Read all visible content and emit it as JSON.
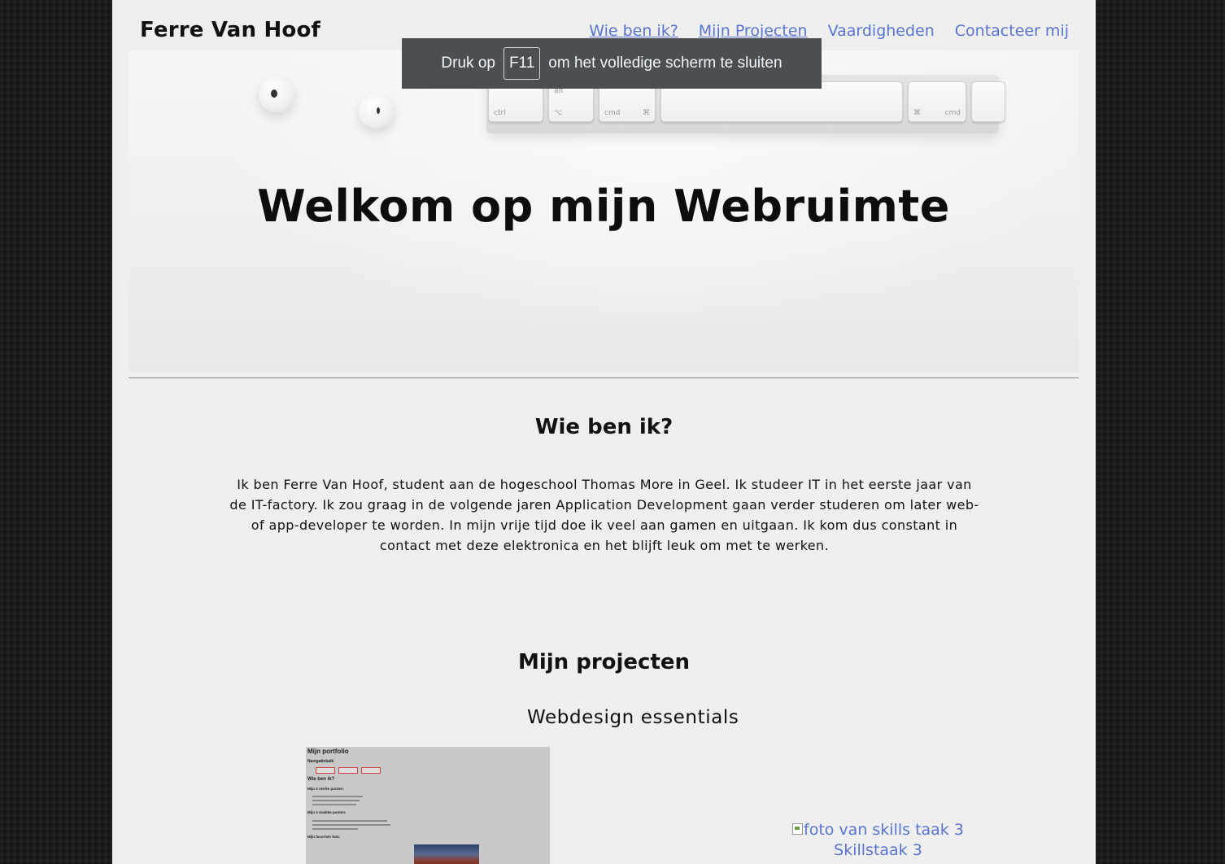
{
  "header": {
    "brand": "Ferre Van Hoof",
    "nav": [
      {
        "label": "Wie ben ik?"
      },
      {
        "label": "Mijn Projecten"
      },
      {
        "label": "Vaardigheden"
      },
      {
        "label": "Contacteer mij"
      }
    ]
  },
  "toast": {
    "before": "Druk op",
    "key": "F11",
    "after": "om het volledige scherm te sluiten"
  },
  "hero": {
    "title": "Welkom op mijn Webruimte",
    "keys": [
      "ctrl",
      "alt",
      "⌥",
      "cmd",
      "⌘",
      "⌘",
      "cmd"
    ]
  },
  "about": {
    "title": "Wie ben ik?",
    "text": "Ik ben Ferre Van Hoof, student aan de hogeschool Thomas More in Geel. Ik studeer IT in het eerste jaar van de IT-factory. Ik zou graag in de volgende jaren Application Development gaan verder studeren om later web- of app-developer te worden. In mijn vrije tijd doe ik veel aan gamen en uitgaan. Ik kom dus constant in contact met deze elektronica en het blijft leuk om met te werken."
  },
  "projects": {
    "title": "Mijn projecten",
    "subtitle": "Webdesign essentials",
    "thumbnail": {
      "heading": "Mijn portfolio",
      "nav_label": "Navigatiebalk",
      "section": "Wie ben ik?",
      "strong": "Mijn 3 sterke punten:",
      "weak": "Mijn 3 zwakke punten:",
      "photo": "Mijn favoriete foto:"
    },
    "broken_image": {
      "alt": "foto van skills taak 3",
      "caption": "Skillstaak 3"
    }
  }
}
